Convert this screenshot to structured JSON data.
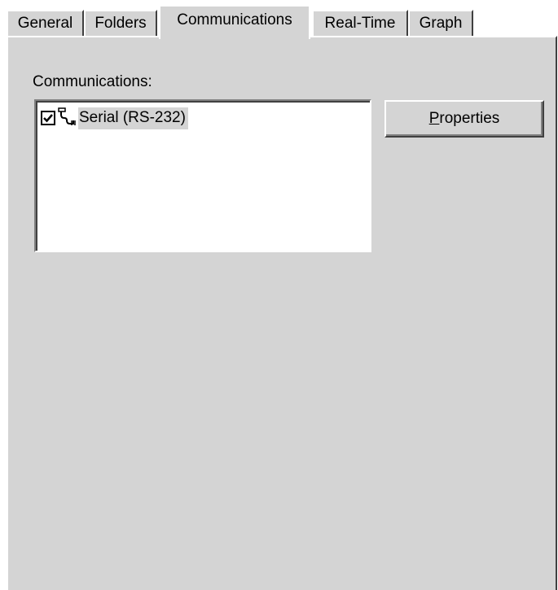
{
  "tabs": [
    {
      "label": "General",
      "active": false
    },
    {
      "label": "Folders",
      "active": false
    },
    {
      "label": "Communications",
      "active": true
    },
    {
      "label": "Real-Time",
      "active": false
    },
    {
      "label": "Graph",
      "active": false
    }
  ],
  "panel": {
    "group_label": "Communications:",
    "list_items": [
      {
        "label": "Serial (RS-232)",
        "checked": true,
        "icon": "serial-cable-icon"
      }
    ],
    "properties_button": {
      "label_accel": "P",
      "label_rest": "roperties"
    }
  },
  "colors": {
    "face": "#d4d4d4",
    "highlight": "#ffffff",
    "shadow": "#808080",
    "dark_shadow": "#404040",
    "window": "#ffffff",
    "text": "#000000"
  }
}
